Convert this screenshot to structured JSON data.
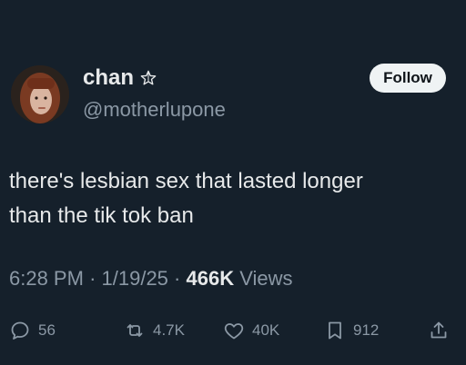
{
  "author": {
    "display_name": "chan",
    "handle": "@motherlupone",
    "badge_icon": "star-outline-icon"
  },
  "follow_label": "Follow",
  "tweet": {
    "line1": "there's lesbian sex that lasted longer",
    "line2": "than the tik tok ban"
  },
  "meta": {
    "time": "6:28 PM",
    "date": "1/19/25",
    "views_count": "466K",
    "views_label": "Views"
  },
  "actions": {
    "replies": "56",
    "reposts": "4.7K",
    "likes": "40K",
    "bookmarks": "912"
  },
  "colors": {
    "background": "#15202b",
    "text": "#e7e9ea",
    "muted": "#8b98a5",
    "button_bg": "#eff3f4"
  }
}
